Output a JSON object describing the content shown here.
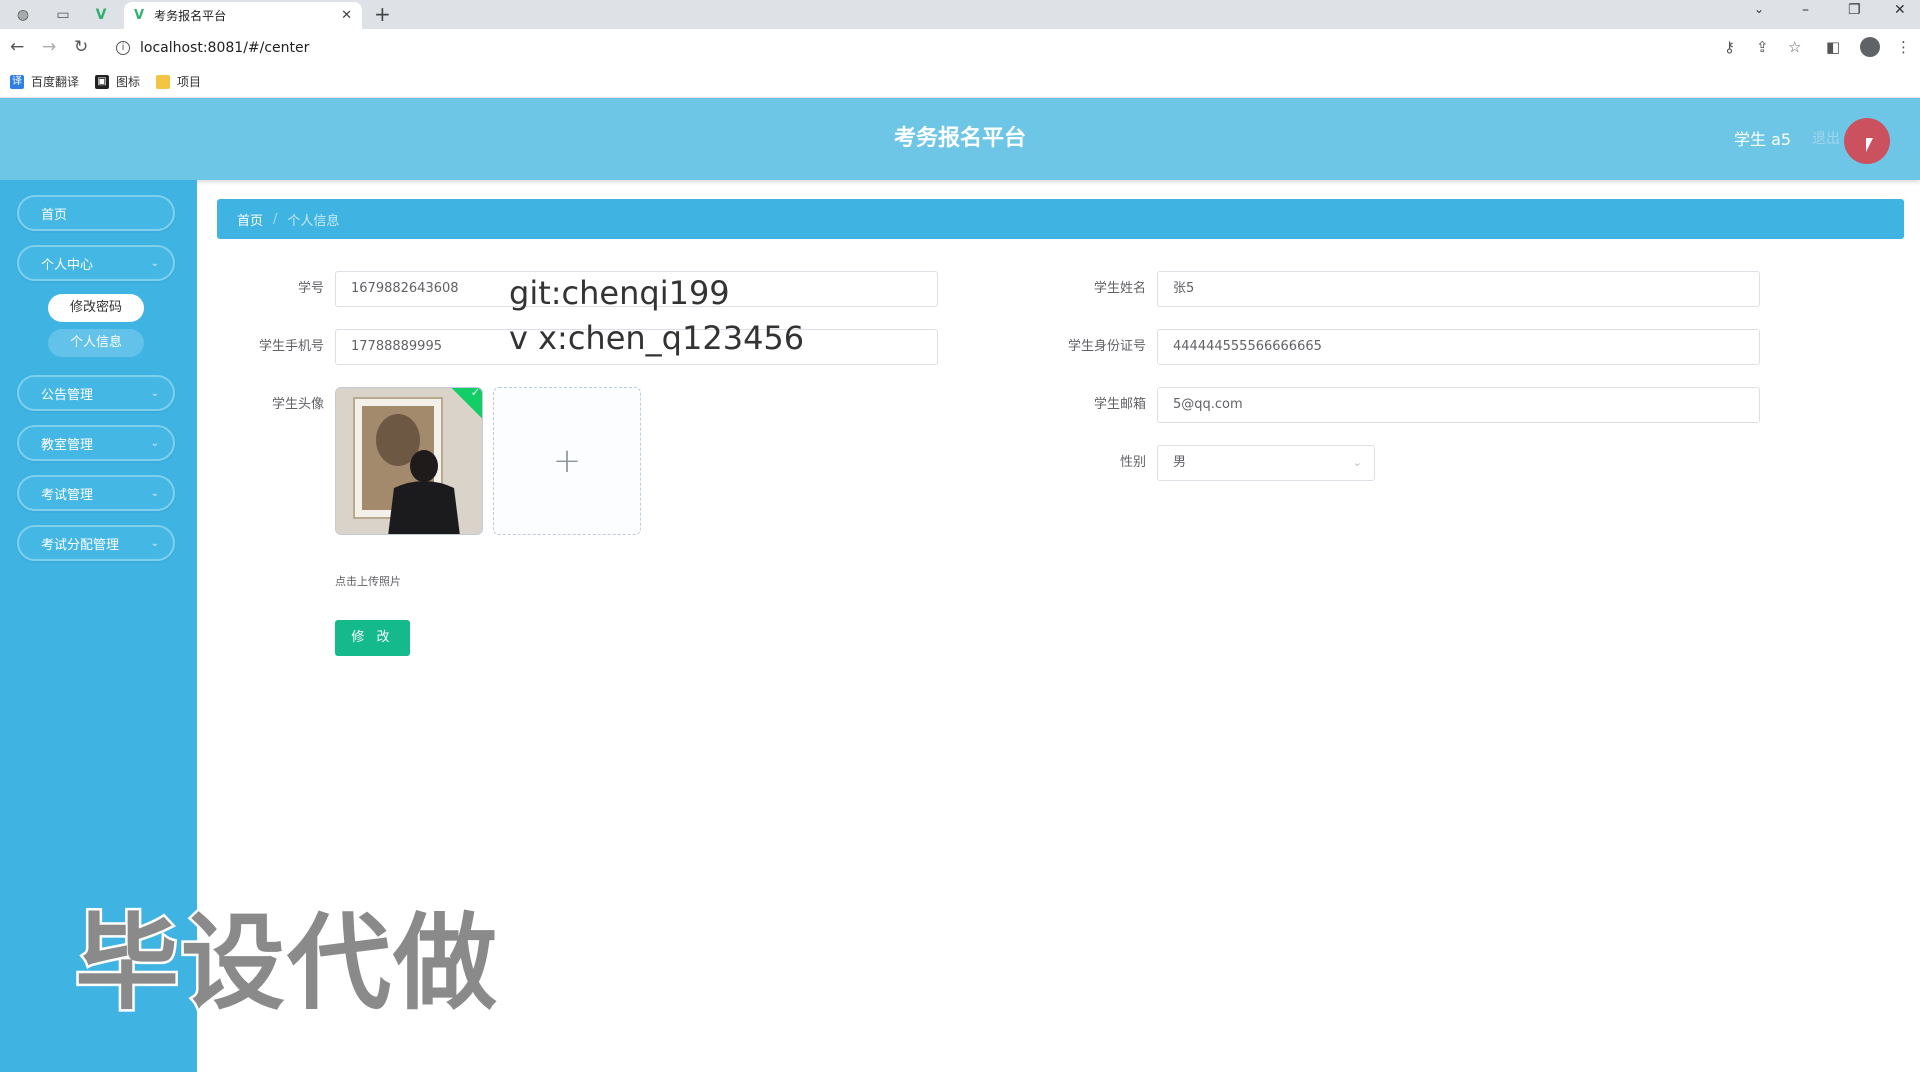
{
  "browser": {
    "tab_title": "考务报名平台",
    "tab_favicon": "V",
    "url": "localhost:8081/#/center",
    "bookmarks": [
      {
        "label": "百度翻译",
        "icon": "translate-icon"
      },
      {
        "label": "图标",
        "icon": "image-icon"
      },
      {
        "label": "项目",
        "icon": "folder-icon"
      }
    ]
  },
  "header": {
    "title": "考务报名平台",
    "user": "学生 a5",
    "logout": "退出"
  },
  "sidebar": {
    "home": "首页",
    "personal_center": "个人中心",
    "change_password": "修改密码",
    "personal_info": "个人信息",
    "notice_mgmt": "公告管理",
    "classroom_mgmt": "教室管理",
    "exam_mgmt": "考试管理",
    "exam_assign_mgmt": "考试分配管理"
  },
  "breadcrumb": {
    "home": "首页",
    "separator": "/",
    "current": "个人信息"
  },
  "form": {
    "student_id_label": "学号",
    "student_id_value": "1679882643608",
    "student_name_label": "学生姓名",
    "student_name_value": "张5",
    "phone_label": "学生手机号",
    "phone_value": "17788889995",
    "id_card_label": "学生身份证号",
    "id_card_value": "444444555566666665",
    "avatar_label": "学生头像",
    "email_label": "学生邮箱",
    "email_value": "5@qq.com",
    "gender_label": "性别",
    "gender_value": "男",
    "upload_tip": "点击上传照片",
    "submit_label": "修 改"
  },
  "overlay": {
    "git": "git:chenqi199",
    "wx": "v x:chen_q123456",
    "watermark": "毕设代做"
  },
  "colors": {
    "header_bg": "#6ec6e6",
    "sidebar_bg": "#3fb4e3",
    "submit_bg": "#14b98c"
  }
}
